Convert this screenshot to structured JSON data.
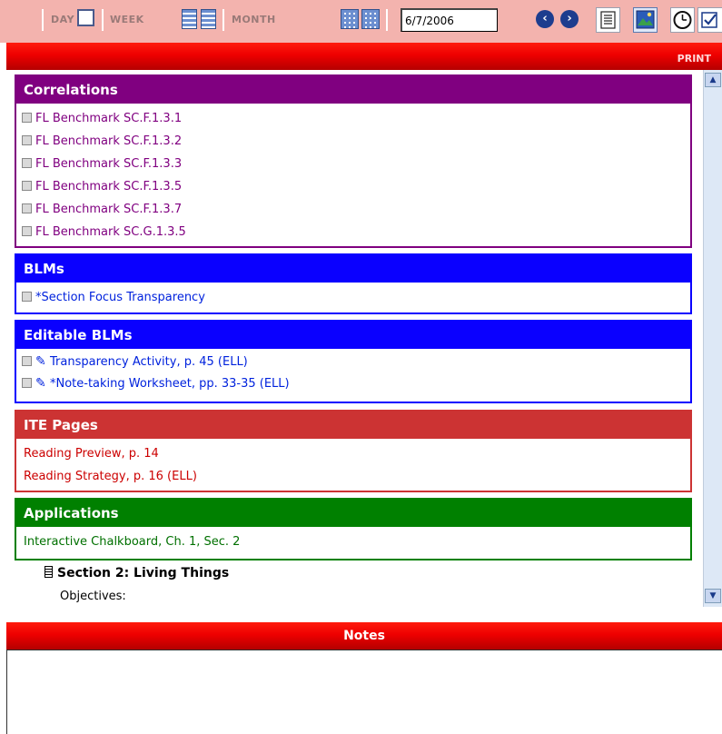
{
  "toolbar": {
    "day_label": "DAY",
    "week_label": "WEEK",
    "month_label": "MONTH",
    "date_value": "6/7/2006",
    "prev_icon": "‹",
    "next_icon": "›"
  },
  "print_label": "PRINT",
  "panels": {
    "correlations": {
      "title": "Correlations",
      "items": [
        "FL Benchmark SC.F.1.3.1",
        "FL Benchmark SC.F.1.3.2",
        "FL Benchmark SC.F.1.3.3",
        "FL Benchmark SC.F.1.3.5",
        "FL Benchmark SC.F.1.3.7",
        "FL Benchmark SC.G.1.3.5"
      ]
    },
    "blms": {
      "title": "BLMs",
      "items": [
        "*Section Focus Transparency"
      ]
    },
    "editable_blms": {
      "title": "Editable BLMs",
      "items": [
        "Transparency Activity, p. 45 (ELL)",
        "*Note-taking Worksheet, pp. 33-35 (ELL)"
      ]
    },
    "ite_pages": {
      "title": "ITE Pages",
      "items": [
        "Reading Preview, p. 14",
        "Reading Strategy, p. 16 (ELL)"
      ]
    },
    "applications": {
      "title": "Applications",
      "items": [
        "Interactive Chalkboard, Ch. 1, Sec. 2"
      ]
    }
  },
  "section": {
    "title": "Section 2: Living Things",
    "objectives_label": "Objectives:"
  },
  "notes": {
    "title": "Notes",
    "value": ""
  },
  "colors": {
    "correlations": "#800080",
    "blms": "#0a00ff",
    "ite_pages": "#cc3333",
    "applications": "#008000",
    "bar_red": "#ee0000",
    "toolbar_bg": "#f3b3ae"
  }
}
